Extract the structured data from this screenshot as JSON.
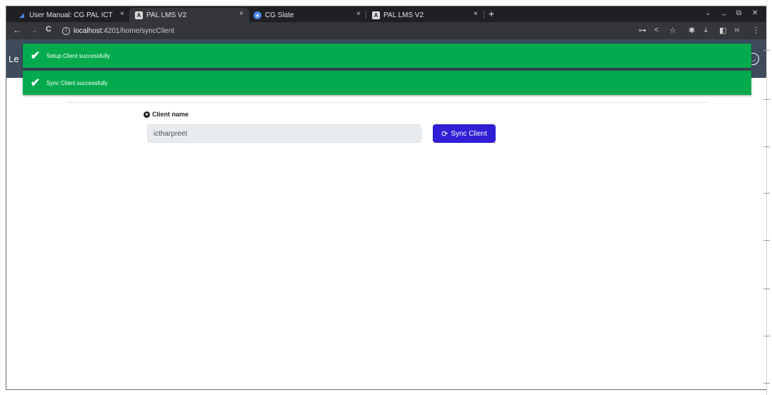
{
  "browser": {
    "tabs": [
      {
        "title": "User Manual: CG PAL ICT",
        "icon": "document-icon"
      },
      {
        "title": "PAL LMS V2",
        "icon": "angular-icon"
      },
      {
        "title": "CG Slate",
        "icon": "slate-icon"
      },
      {
        "title": "PAL LMS V2",
        "icon": "angular-icon"
      }
    ],
    "tab_close": "×",
    "new_tab": "+",
    "window_controls": {
      "dropdown": "⌄",
      "minimize": "_",
      "restore": "⧉",
      "close": "✕"
    },
    "nav": {
      "back": "←",
      "forward": "→",
      "reload": "C"
    },
    "address": {
      "info": "i",
      "host": "localhost",
      "path": ":4201/home/syncClient"
    },
    "toolbar_icons": {
      "key": "⊶",
      "share": "<",
      "star": "☆",
      "extensions": "✱",
      "download": "⤓",
      "sidepanel": "◧",
      "profile": "H",
      "menu": "⋮"
    }
  },
  "app": {
    "brand_partial": "Le",
    "avatar_icon": "user-icon"
  },
  "toasts": [
    {
      "message": "Setup Client successfully",
      "color": "#03ab4d"
    },
    {
      "message": "Sync Client successfully",
      "color": "#03ab4d"
    }
  ],
  "form": {
    "label": "Client name",
    "value": "ictharpreet",
    "sync_button": "Sync Client"
  },
  "colors": {
    "header": "#3d4b5d",
    "primary_button": "#2f1fd6",
    "toast": "#03ab4d"
  }
}
